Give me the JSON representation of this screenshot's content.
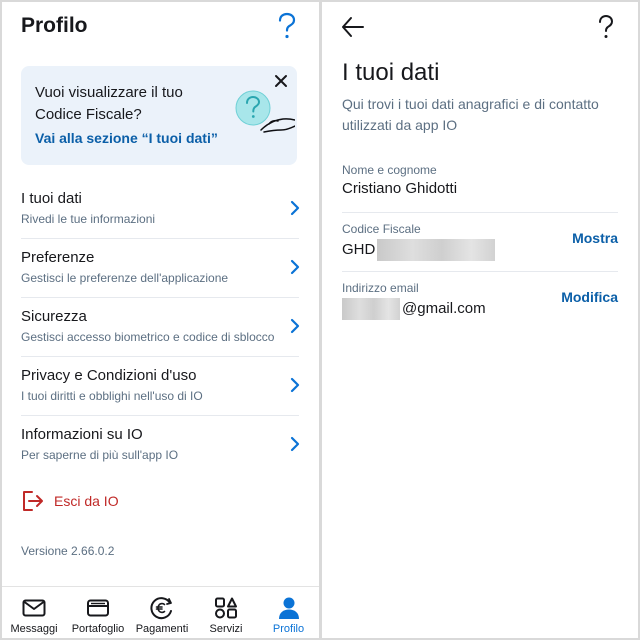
{
  "profile": {
    "title": "Profilo",
    "banner": {
      "title": "Vuoi visualizzare il tuo Codice Fiscale?",
      "link": "Vai alla sezione “I tuoi dati”"
    },
    "menu": [
      {
        "title": "I tuoi dati",
        "subtitle": "Rivedi le tue informazioni"
      },
      {
        "title": "Preferenze",
        "subtitle": "Gestisci le preferenze dell'applicazione"
      },
      {
        "title": "Sicurezza",
        "subtitle": "Gestisci accesso biometrico e codice di sblocco"
      },
      {
        "title": "Privacy e Condizioni d'uso",
        "subtitle": "I tuoi diritti e obblighi nell'uso di IO"
      },
      {
        "title": "Informazioni su IO",
        "subtitle": "Per saperne di più sull'app IO"
      }
    ],
    "logout": "Esci da IO",
    "version": "Versione 2.66.0.2"
  },
  "tabbar": {
    "tabs": [
      {
        "label": "Messaggi",
        "icon": "envelope-icon",
        "active": false
      },
      {
        "label": "Portafoglio",
        "icon": "wallet-icon",
        "active": false
      },
      {
        "label": "Pagamenti",
        "icon": "euro-coin-icon",
        "active": false
      },
      {
        "label": "Servizi",
        "icon": "services-grid-icon",
        "active": false
      },
      {
        "label": "Profilo",
        "icon": "person-icon",
        "active": true
      }
    ],
    "active_color": "#0b73d6"
  },
  "data_screen": {
    "title": "I tuoi dati",
    "description": "Qui trovi i tuoi dati anagrafici e di contatto utilizzati da app IO",
    "fields": [
      {
        "label": "Nome e cognome",
        "value": "Cristiano Ghidotti",
        "action": ""
      },
      {
        "label": "Codice Fiscale",
        "value": "GHD",
        "action": "Mostra"
      },
      {
        "label": "Indirizzo email",
        "value": "@gmail.com",
        "action": "Modifica"
      }
    ]
  },
  "colors": {
    "accent": "#0b5fa8",
    "danger": "#c02927",
    "banner_bg": "#ebf2fa",
    "muted_text": "#5c6f82"
  }
}
